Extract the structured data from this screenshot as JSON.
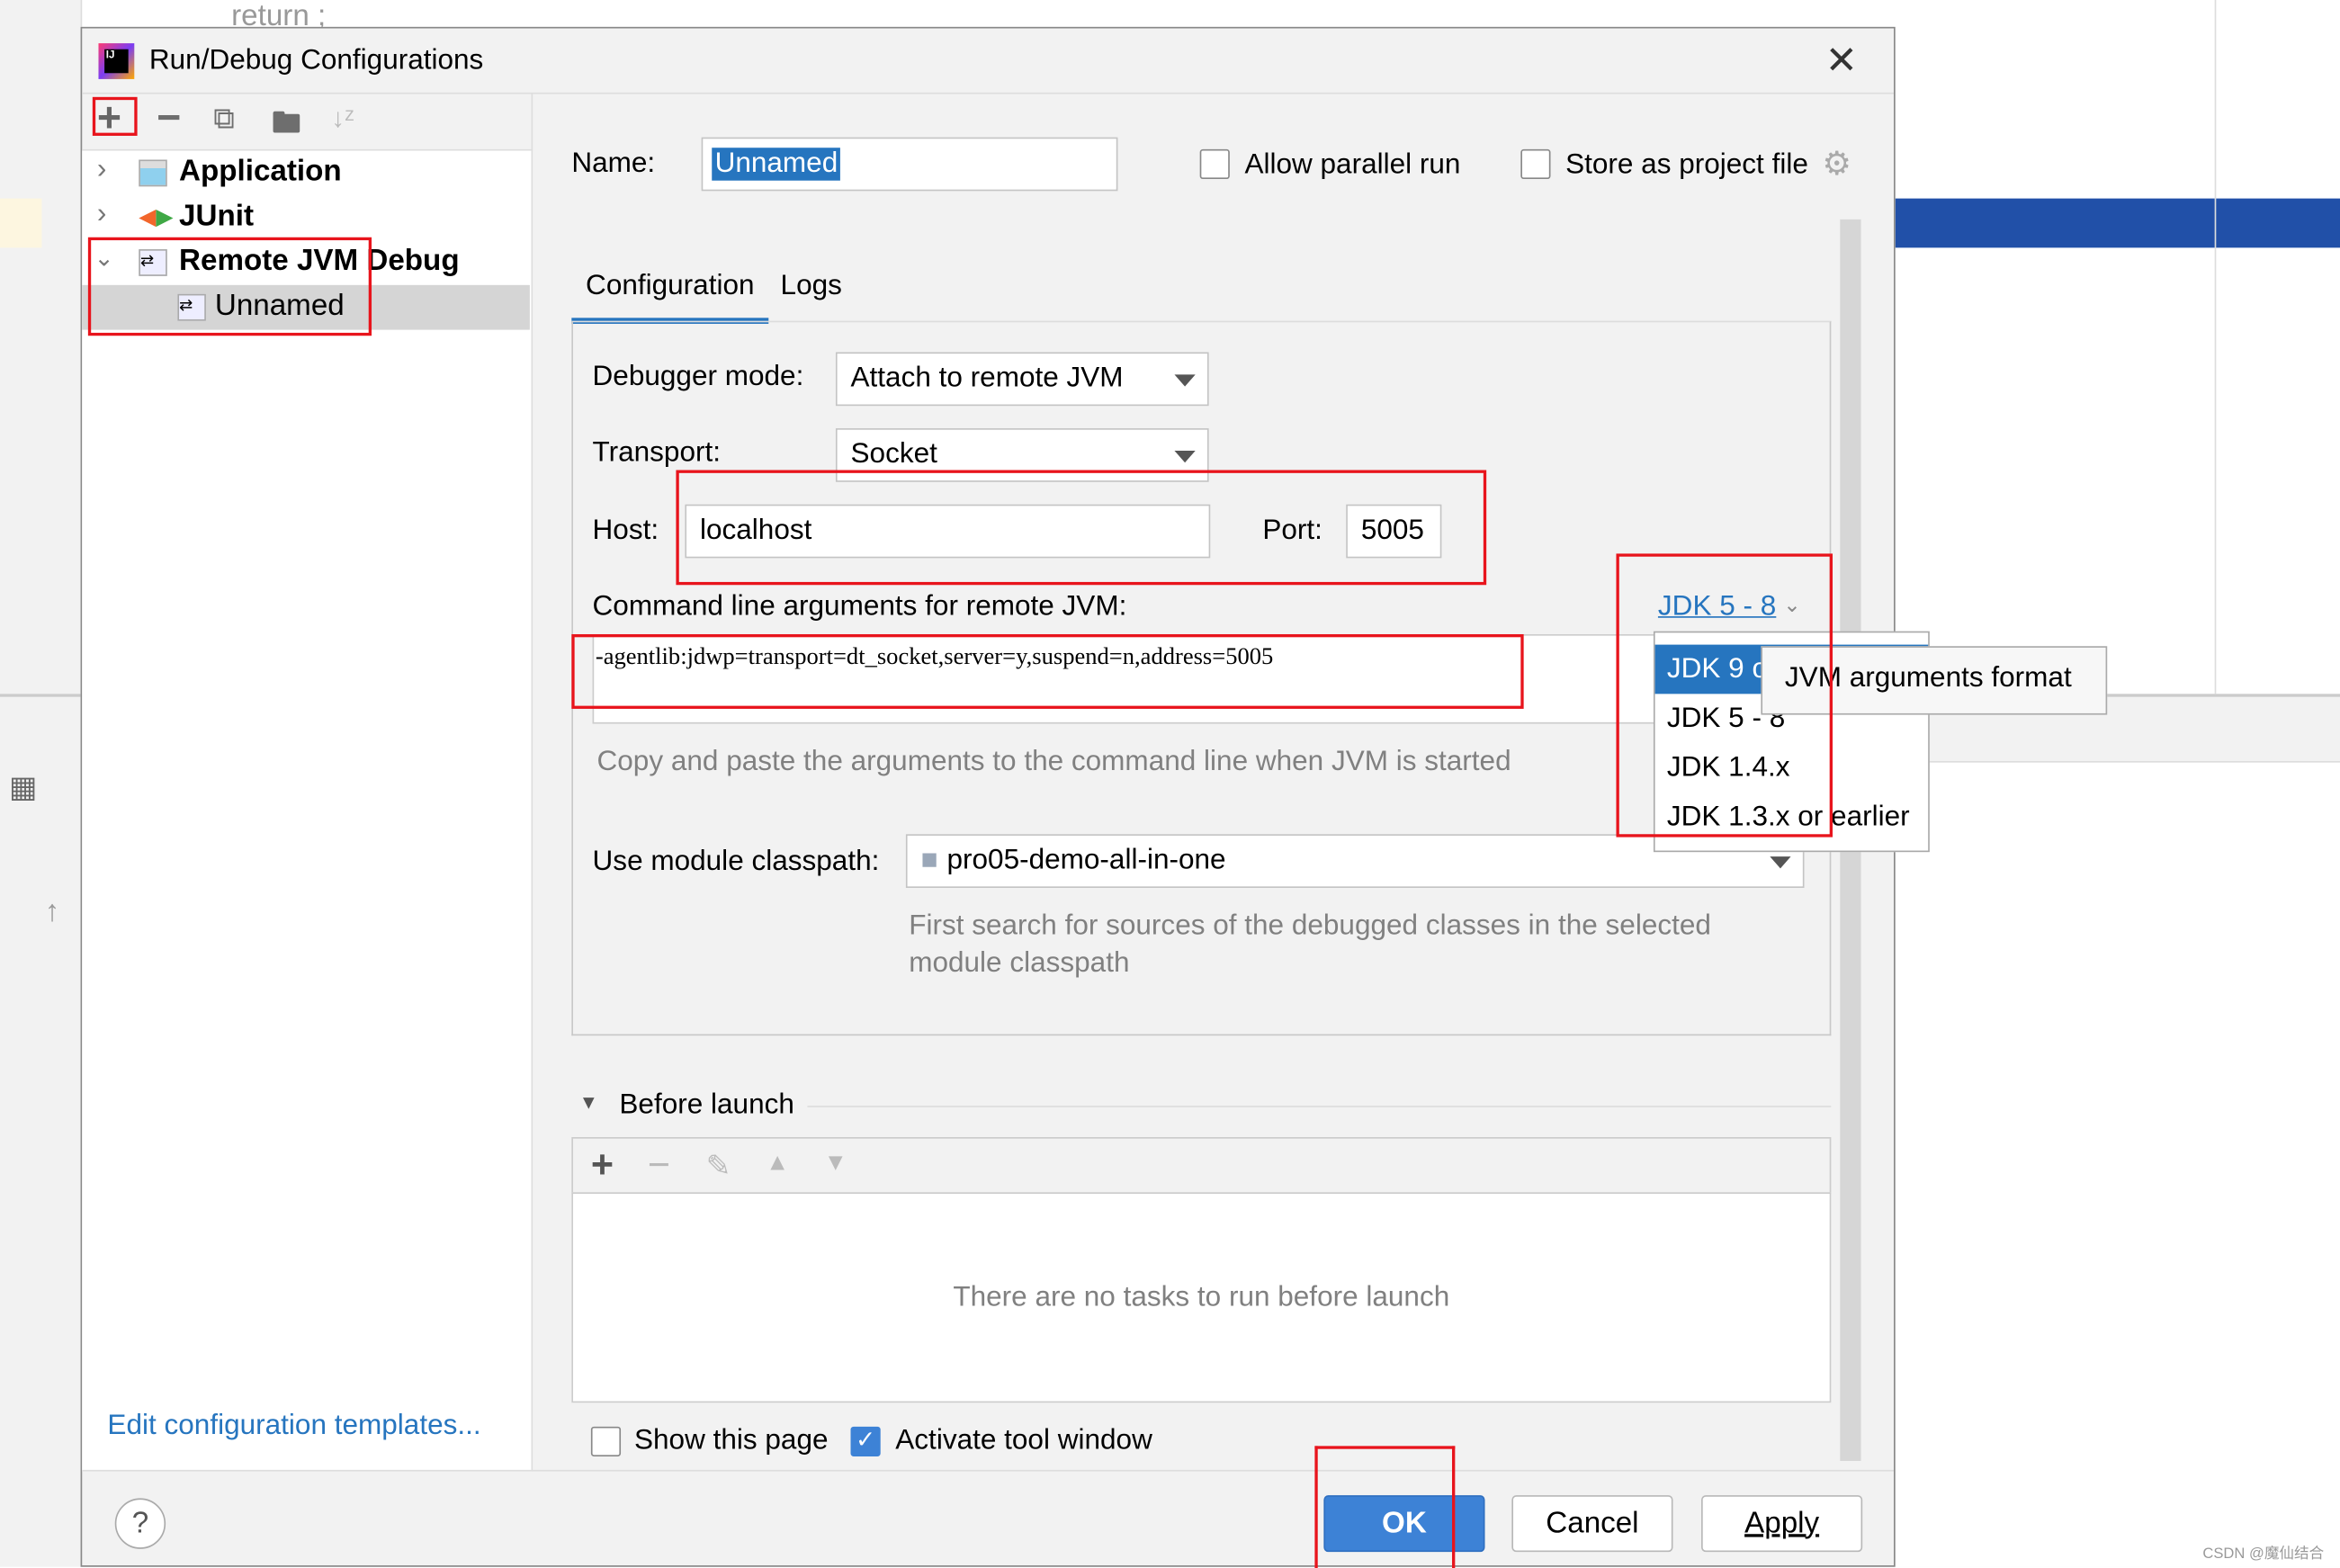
{
  "editor": {
    "code_fragment": "return ;"
  },
  "dialog": {
    "title": "Run/Debug Configurations",
    "toolbar": {
      "add": "+",
      "remove": "−",
      "copy": "copy",
      "folder": "new folder",
      "sort": "sort"
    },
    "tree": [
      {
        "label": "Application",
        "expanded": false
      },
      {
        "label": "JUnit",
        "expanded": false
      },
      {
        "label": "Remote JVM Debug",
        "expanded": true,
        "children": [
          {
            "label": "Unnamed",
            "selected": true
          }
        ]
      }
    ],
    "edit_templates_link": "Edit configuration templates...",
    "name_label": "Name:",
    "name_value": "Unnamed",
    "allow_parallel_label": "Allow parallel run",
    "allow_parallel_checked": false,
    "store_project_label": "Store as project file",
    "store_project_checked": false,
    "tabs": [
      {
        "label": "Configuration",
        "active": true
      },
      {
        "label": "Logs",
        "active": false
      }
    ],
    "debugger_mode_label": "Debugger mode:",
    "debugger_mode_value": "Attach to remote JVM",
    "transport_label": "Transport:",
    "transport_value": "Socket",
    "host_label": "Host:",
    "host_value": "localhost",
    "port_label": "Port:",
    "port_value": "5005",
    "cmd_label": "Command line arguments for remote JVM:",
    "jdk_link": "JDK 5 - 8",
    "cmd_value": "-agentlib:jdwp=transport=dt_socket,server=y,suspend=n,address=5005",
    "cmd_hint": "Copy and paste the arguments to the command line when JVM is started",
    "jdk_menu": [
      {
        "label": "JDK 9 or later",
        "highlighted": true
      },
      {
        "label": "JDK 5 - 8"
      },
      {
        "label": "JDK 1.4.x"
      },
      {
        "label": "JDK 1.3.x or earlier"
      }
    ],
    "tooltip": "JVM arguments format",
    "module_label": "Use module classpath:",
    "module_value": "pro05-demo-all-in-one",
    "module_hint": "First search for sources of the debugged classes in the selected module classpath",
    "before_launch_label": "Before launch",
    "no_tasks": "There are no tasks to run before launch",
    "show_page_label": "Show this page",
    "show_page_checked": false,
    "activate_tool_label": "Activate tool window",
    "activate_tool_checked": true,
    "ok": "OK",
    "cancel": "Cancel",
    "apply": "Apply",
    "help": "?"
  },
  "watermark": "CSDN @魔仙结合",
  "colors": {
    "accent": "#2675bf",
    "selection": "#2675bf",
    "highlight_red": "#e8141c",
    "editor_line": "#2150a8"
  }
}
